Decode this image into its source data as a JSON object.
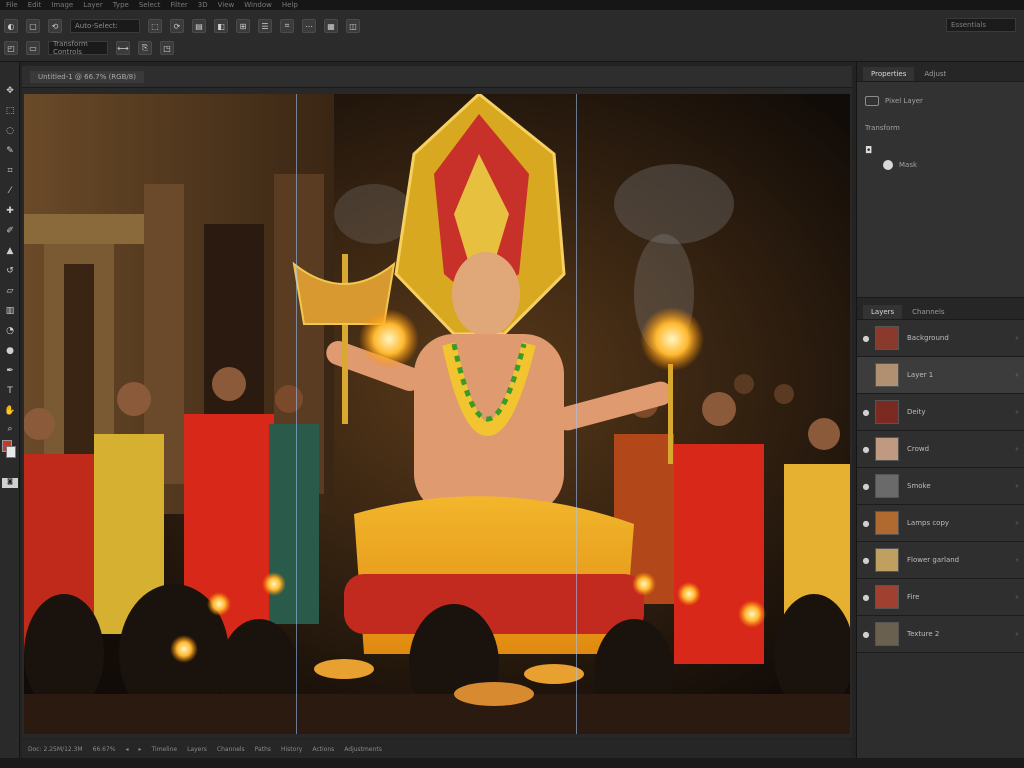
{
  "menu": [
    "File",
    "Edit",
    "Image",
    "Layer",
    "Type",
    "Select",
    "Filter",
    "3D",
    "View",
    "Window",
    "Help"
  ],
  "options_row1": {
    "field_text": "Auto-Select:",
    "buttons": [
      "◐",
      "▢",
      "⟲",
      "⬚",
      "⟳",
      "▤",
      "◧",
      "⊞",
      "☰",
      "⌗",
      "⋯",
      "▦",
      "◫"
    ]
  },
  "options_row2": {
    "buttons": [
      "◰",
      "▭",
      "⟷",
      "⎘",
      "◳"
    ],
    "field_text": "Transform Controls"
  },
  "workspace_label": "Essentials",
  "document_tab": "Untitled-1 @ 66.7% (RGB/8)",
  "status": [
    "Doc: 2.25M/12.3M",
    "66.67%",
    "◂",
    "▸",
    "Timeline",
    "Layers",
    "Channels",
    "Paths",
    "History",
    "Actions",
    "Adjustments"
  ],
  "properties_panel": {
    "tabs": [
      "Properties",
      "Adjust"
    ],
    "title": "Pixel Layer",
    "sub": "Transform",
    "item": "Mask"
  },
  "layers_panel": {
    "tabs": [
      "Layers",
      "Channels"
    ],
    "layers": [
      {
        "name": "Background",
        "visible": true,
        "selected": false,
        "color": "#8a3a2a"
      },
      {
        "name": "Layer 1",
        "visible": false,
        "selected": true,
        "color": "#b09070"
      },
      {
        "name": "Deity",
        "visible": true,
        "selected": false,
        "color": "#7a2a20"
      },
      {
        "name": "Crowd",
        "visible": true,
        "selected": false,
        "color": "#c09a80"
      },
      {
        "name": "Smoke",
        "visible": true,
        "selected": false,
        "color": "#6a6a6a"
      },
      {
        "name": "Lamps copy",
        "visible": true,
        "selected": false,
        "color": "#b06a30"
      },
      {
        "name": "Flower garland",
        "visible": true,
        "selected": false,
        "color": "#c0a060"
      },
      {
        "name": "Fire",
        "visible": true,
        "selected": false,
        "color": "#a04030"
      },
      {
        "name": "Texture 2",
        "visible": true,
        "selected": false,
        "color": "#6a6050"
      }
    ]
  },
  "accent_color": "#c23a2a"
}
